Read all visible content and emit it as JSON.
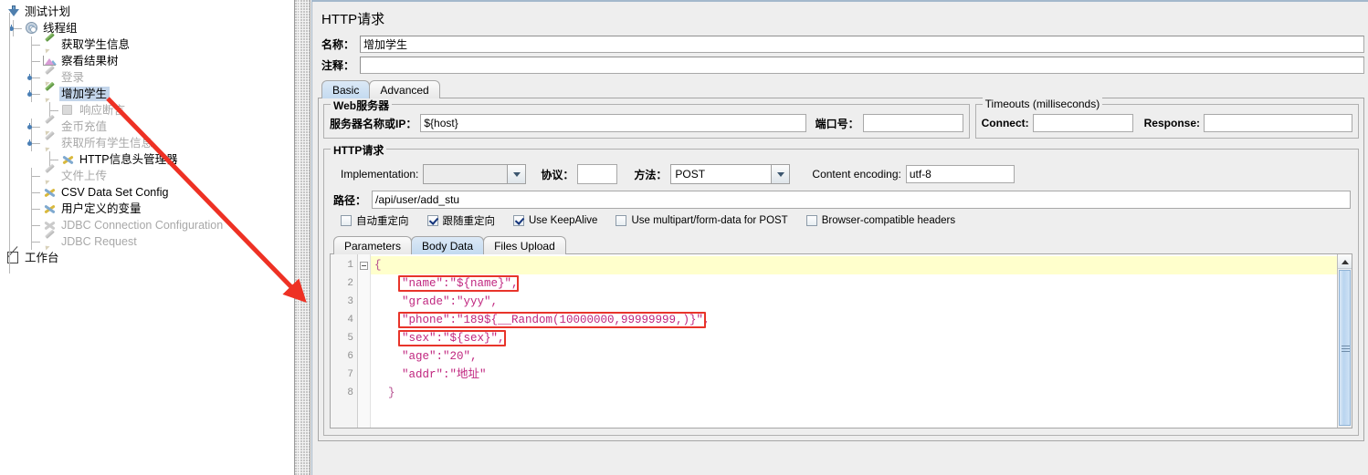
{
  "tree": {
    "items": [
      {
        "label": "测试计划",
        "icon": "test-plan-icon",
        "depth": 0,
        "disabled": false,
        "selected": false,
        "expander": true
      },
      {
        "label": "线程组",
        "icon": "thread-group-icon",
        "depth": 1,
        "disabled": false,
        "selected": false,
        "expander": true
      },
      {
        "label": "获取学生信息",
        "icon": "http-sampler-icon",
        "depth": 2,
        "disabled": false,
        "selected": false,
        "expander": false
      },
      {
        "label": "察看结果树",
        "icon": "view-results-tree-icon",
        "depth": 2,
        "disabled": false,
        "selected": false,
        "expander": false
      },
      {
        "label": "登录",
        "icon": "http-sampler-icon",
        "depth": 2,
        "disabled": true,
        "selected": false,
        "expander": true
      },
      {
        "label": "增加学生",
        "icon": "http-sampler-icon",
        "depth": 2,
        "disabled": false,
        "selected": true,
        "expander": true
      },
      {
        "label": "响应断言",
        "icon": "assertion-icon",
        "depth": 3,
        "disabled": true,
        "selected": false,
        "expander": false
      },
      {
        "label": "金币充值",
        "icon": "http-sampler-icon",
        "depth": 2,
        "disabled": true,
        "selected": false,
        "expander": true
      },
      {
        "label": "获取所有学生信息",
        "icon": "http-sampler-icon",
        "depth": 2,
        "disabled": true,
        "selected": false,
        "expander": true
      },
      {
        "label": "HTTP信息头管理器",
        "icon": "header-manager-icon",
        "depth": 3,
        "disabled": false,
        "selected": false,
        "expander": false
      },
      {
        "label": "文件上传",
        "icon": "http-sampler-icon",
        "depth": 2,
        "disabled": true,
        "selected": false,
        "expander": false
      },
      {
        "label": "CSV Data Set Config",
        "icon": "csv-config-icon",
        "depth": 2,
        "disabled": false,
        "selected": false,
        "expander": false
      },
      {
        "label": "用户定义的变量",
        "icon": "user-variables-icon",
        "depth": 2,
        "disabled": false,
        "selected": false,
        "expander": false
      },
      {
        "label": "JDBC Connection Configuration",
        "icon": "jdbc-config-icon",
        "depth": 2,
        "disabled": true,
        "selected": false,
        "expander": false
      },
      {
        "label": "JDBC Request",
        "icon": "jdbc-request-icon",
        "depth": 2,
        "disabled": true,
        "selected": false,
        "expander": false
      },
      {
        "label": "工作台",
        "icon": "workbench-icon",
        "depth": 0,
        "disabled": false,
        "selected": false,
        "expander": false
      }
    ]
  },
  "panel": {
    "title": "HTTP请求",
    "name_label": "名称：",
    "name_value": "增加学生",
    "comment_label": "注释：",
    "comment_value": "",
    "tabs": [
      {
        "label": "Basic",
        "active": true
      },
      {
        "label": "Advanced",
        "active": false
      }
    ],
    "web_server": {
      "group_title": "Web服务器",
      "server_label": "服务器名称或IP：",
      "server_value": "${host}",
      "port_label": "端口号：",
      "port_value": ""
    },
    "timeouts": {
      "group_title": "Timeouts (milliseconds)",
      "connect_label": "Connect:",
      "connect_value": "",
      "response_label": "Response:",
      "response_value": ""
    },
    "http_request": {
      "group_title": "HTTP请求",
      "implementation_label": "Implementation:",
      "implementation_value": "",
      "protocol_label": "协议：",
      "protocol_value": "",
      "method_label": "方法：",
      "method_value": "POST",
      "content_encoding_label": "Content encoding:",
      "content_encoding_value": "utf-8",
      "path_label": "路径：",
      "path_value": "/api/user/add_stu",
      "checkboxes": [
        {
          "label": "自动重定向",
          "checked": false
        },
        {
          "label": "跟随重定向",
          "checked": true
        },
        {
          "label": "Use KeepAlive",
          "checked": true
        },
        {
          "label": "Use multipart/form-data for POST",
          "checked": false
        },
        {
          "label": "Browser-compatible headers",
          "checked": false
        }
      ],
      "inner_tabs": [
        {
          "label": "Parameters",
          "active": false
        },
        {
          "label": "Body Data",
          "active": true
        },
        {
          "label": "Files Upload",
          "active": false
        }
      ]
    },
    "body_editor": {
      "lines": [
        {
          "no": "1",
          "text": "{",
          "fold": true,
          "current": true,
          "highlight": false
        },
        {
          "no": "2",
          "text": "    \"name\":\"${name}\",",
          "fold": false,
          "current": false,
          "highlight": true
        },
        {
          "no": "3",
          "text": "    \"grade\":\"yyy\",",
          "fold": false,
          "current": false,
          "highlight": false
        },
        {
          "no": "4",
          "text": "    \"phone\":\"189${__Random(10000000,99999999,)}\",",
          "fold": false,
          "current": false,
          "highlight": true
        },
        {
          "no": "5",
          "text": "    \"sex\":\"${sex}\",",
          "fold": false,
          "current": false,
          "highlight": true
        },
        {
          "no": "6",
          "text": "    \"age\":\"20\",",
          "fold": false,
          "current": false,
          "highlight": false
        },
        {
          "no": "7",
          "text": "    \"addr\":\"地址\"",
          "fold": false,
          "current": false,
          "highlight": false
        },
        {
          "no": "8",
          "text": "  }",
          "fold": false,
          "current": false,
          "highlight": false
        }
      ]
    }
  },
  "colors": {
    "selection_blue": "#c3d5ea",
    "tab_active_blue": "#c3daf0",
    "annotation_red": "#e8342a",
    "code_text": "#c0267f",
    "current_line_yellow": "#ffffcc"
  }
}
